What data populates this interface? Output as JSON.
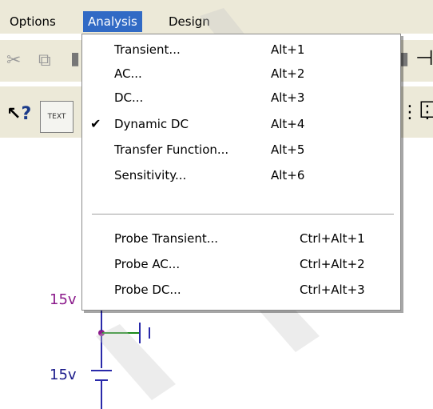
{
  "menubar": {
    "items": [
      {
        "label": "Options",
        "active": false
      },
      {
        "label": "Analysis",
        "active": true
      },
      {
        "label": "Design",
        "active": false
      }
    ]
  },
  "toolbar": {
    "text_button": "TEXT"
  },
  "analysis_menu": {
    "items": [
      {
        "label": "Transient...",
        "shortcut": "Alt+1",
        "checked": false
      },
      {
        "label": "AC...",
        "shortcut": "Alt+2",
        "checked": false
      },
      {
        "label": "DC...",
        "shortcut": "Alt+3",
        "checked": false
      },
      {
        "label": "Dynamic DC",
        "shortcut": "Alt+4",
        "checked": true
      },
      {
        "label": "Transfer Function...",
        "shortcut": "Alt+5",
        "checked": false
      },
      {
        "label": "Sensitivity...",
        "shortcut": "Alt+6",
        "checked": false
      },
      {
        "label": "Probe Transient...",
        "shortcut": "Ctrl+Alt+1",
        "checked": false
      },
      {
        "label": "Probe AC...",
        "shortcut": "Ctrl+Alt+2",
        "checked": false
      },
      {
        "label": "Probe DC...",
        "shortcut": "Ctrl+Alt+3",
        "checked": false
      }
    ]
  },
  "schematic": {
    "label_top": "15v",
    "label_bottom": "15v"
  },
  "colors": {
    "menu_highlight": "#316ac5",
    "toolbar_bg": "#ece9d8",
    "node": "#8b1a8b",
    "wire": "#2a2aaa"
  }
}
